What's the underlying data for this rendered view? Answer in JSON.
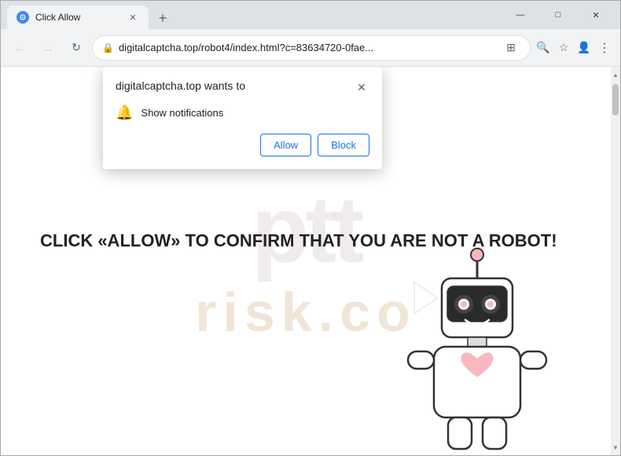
{
  "window": {
    "title": "Click Allow",
    "controls": {
      "minimize": "—",
      "maximize": "□",
      "close": "✕"
    }
  },
  "tab": {
    "favicon_label": "G",
    "title": "Click Allow",
    "close_icon": "✕"
  },
  "new_tab_btn": "+",
  "nav": {
    "back_icon": "←",
    "forward_icon": "→",
    "reload_icon": "↻",
    "address": "digitalcaptcha.top/robot4/index.html?c=83634720-0fae...",
    "lock_icon": "🔒",
    "translate_icon": "⊞",
    "search_icon": "🔍",
    "star_icon": "☆",
    "profile_icon": "👤",
    "menu_icon": "⋮",
    "download_icon": "⬇"
  },
  "popup": {
    "title": "digitalcaptcha.top wants to",
    "close_icon": "✕",
    "bell_icon": "🔔",
    "notification_label": "Show notifications",
    "allow_label": "Allow",
    "block_label": "Block"
  },
  "page": {
    "captcha_message": "CLICK «ALLOW» TO CONFIRM THAT YOU ARE NOT A ROBOT!",
    "watermark_top": "ptt",
    "watermark_bottom": "risk.co"
  }
}
